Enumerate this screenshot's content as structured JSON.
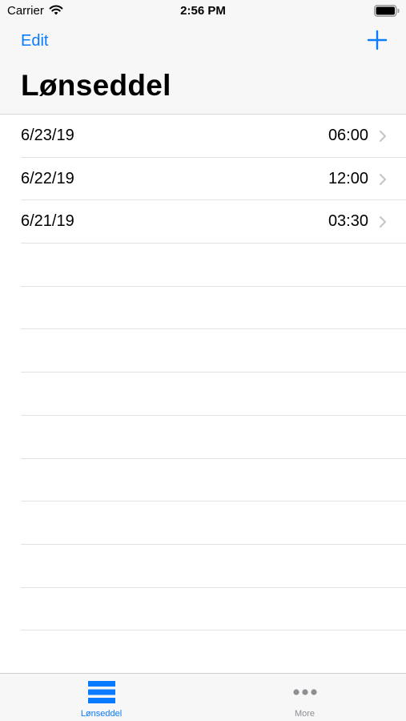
{
  "status_bar": {
    "carrier": "Carrier",
    "time": "2:56 PM",
    "wifi_icon": "wifi-icon",
    "battery_icon": "battery-icon"
  },
  "nav": {
    "edit_label": "Edit",
    "add_icon": "plus-icon",
    "title": "Lønseddel"
  },
  "colors": {
    "accent": "#0a7aff",
    "inactive": "#8e8e93",
    "separator": "#e2e2e6",
    "bar_background": "#f7f7f7"
  },
  "entries": [
    {
      "date": "6/23/19",
      "hours": "06:00"
    },
    {
      "date": "6/22/19",
      "hours": "12:00"
    },
    {
      "date": "6/21/19",
      "hours": "03:30"
    }
  ],
  "tabs": [
    {
      "label": "Lønseddel",
      "icon": "list-icon",
      "selected": true
    },
    {
      "label": "More",
      "icon": "more-icon",
      "selected": false
    }
  ]
}
